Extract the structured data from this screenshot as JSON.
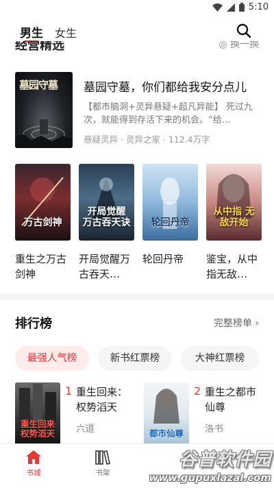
{
  "status_bar": {
    "time": "5:10",
    "icons": [
      "wifi-icon",
      "signal-icon",
      "battery-icon"
    ]
  },
  "top_nav": {
    "tabs": [
      {
        "label": "男生",
        "active": true
      },
      {
        "label": "女生",
        "active": false
      }
    ],
    "search_icon": "search-icon"
  },
  "section_stub": {
    "title": "经营精选",
    "action": "◎ 换一换"
  },
  "featured": {
    "title": "墓园守墓，你们都给我安分点儿",
    "description": "【都市脑洞+灵异悬疑+超凡异能】 死过九次，就能得到存活下来的机会。“给…",
    "meta": "悬疑灵异 · 灵异之家 · 112.4万字",
    "cover_text": "墓园守墓"
  },
  "book_row": [
    {
      "title": "重生之万古剑神",
      "cover_text": "万古剑神"
    },
    {
      "title": "开局觉醒万古吞天…",
      "cover_text": "开局觉醒 万古吞天诀"
    },
    {
      "title": "轮回丹帝",
      "cover_text": "轮回丹帝"
    },
    {
      "title": "鉴宝，从中指无敌…",
      "cover_text": "从中指 无敌开始"
    }
  ],
  "ranking": {
    "title": "排行榜",
    "more": "完整榜单 ›",
    "tabs": [
      {
        "label": "最强人气榜",
        "active": true
      },
      {
        "label": "新书红票榜",
        "active": false
      },
      {
        "label": "大神红票榜",
        "active": false
      }
    ],
    "items": [
      {
        "rank": "1",
        "title": "重生回来：权势滔天",
        "author": "六道",
        "cover_text": "重生回来 权势滔天"
      },
      {
        "rank": "2",
        "title": "重生之都市仙尊",
        "author": "洛书",
        "cover_text": "都市仙尊"
      }
    ]
  },
  "bottom_nav": [
    {
      "label": "书城",
      "icon": "home-icon",
      "active": true
    },
    {
      "label": "书架",
      "icon": "bookshelf-icon",
      "active": false
    }
  ],
  "watermark": {
    "main": "谷普软件园",
    "sub": "www.gupuxlazal.com"
  },
  "colors": {
    "accent": "#e53935",
    "accent_bg": "#fdecea"
  }
}
